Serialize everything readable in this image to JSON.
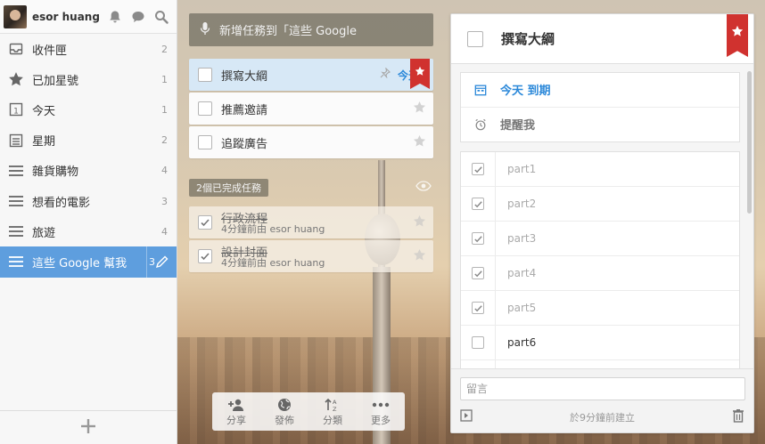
{
  "sidebar": {
    "user_name": "esor huang",
    "items": [
      {
        "label": "收件匣",
        "count": "2",
        "icon": "inbox-icon"
      },
      {
        "label": "已加星號",
        "count": "1",
        "icon": "star-icon"
      },
      {
        "label": "今天",
        "count": "1",
        "icon": "today-calendar-icon"
      },
      {
        "label": "星期",
        "count": "2",
        "icon": "week-calendar-icon"
      },
      {
        "label": "雜貨購物",
        "count": "4",
        "icon": "list-icon"
      },
      {
        "label": "想看的電影",
        "count": "3",
        "icon": "list-icon"
      },
      {
        "label": "旅遊",
        "count": "4",
        "icon": "list-icon"
      },
      {
        "label": "這些 Google 幫我",
        "count": "3",
        "icon": "list-icon",
        "active": true
      }
    ]
  },
  "tasks": {
    "add_placeholder": "新增任務到「這些 Google",
    "items": [
      {
        "title": "撰寫大綱",
        "due": "今天",
        "starred": true,
        "selected": true
      },
      {
        "title": "推薦邀請",
        "due": "",
        "starred": false
      },
      {
        "title": "追蹤廣告",
        "due": "",
        "starred": false
      }
    ],
    "completed_header": "2個已完成任務",
    "completed": [
      {
        "title": "行政流程",
        "meta": "4分鐘前由 esor huang"
      },
      {
        "title": "設計封面",
        "meta": "4分鐘前由 esor huang"
      }
    ]
  },
  "toolbar": [
    {
      "label": "分享",
      "icon": "add-user-icon"
    },
    {
      "label": "發佈",
      "icon": "globe-icon"
    },
    {
      "label": "分類",
      "icon": "sort-az-icon"
    },
    {
      "label": "更多",
      "icon": "more-dots-icon"
    }
  ],
  "detail": {
    "title": "撰寫大綱",
    "due_label": "今天 到期",
    "reminder_label": "提醒我",
    "subtasks": [
      {
        "title": "part1",
        "done": true
      },
      {
        "title": "part2",
        "done": true
      },
      {
        "title": "part3",
        "done": true
      },
      {
        "title": "part4",
        "done": true
      },
      {
        "title": "part5",
        "done": true
      },
      {
        "title": "part6",
        "done": false
      }
    ],
    "comment_placeholder": "留言",
    "created_text": "於9分鐘前建立"
  },
  "colors": {
    "accent": "#5e9ede",
    "flag": "#d0322f",
    "due": "#2b88d9"
  }
}
